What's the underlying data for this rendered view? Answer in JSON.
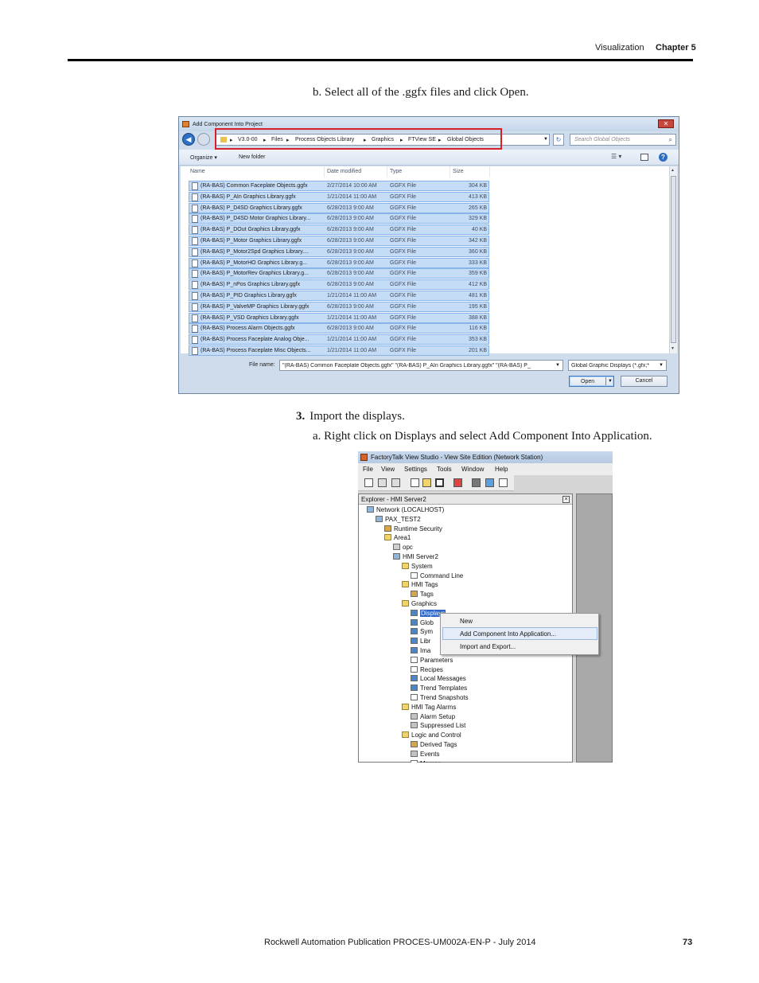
{
  "header": {
    "section": "Visualization",
    "chapter": "Chapter 5"
  },
  "step_b": "b. Select all of the .ggfx files and click Open.",
  "step_3": {
    "num": "3.",
    "text": "Import the displays."
  },
  "step_a": "a. Right click on Displays and select Add Component Into Application.",
  "dialog": {
    "title": "Add Component Into Project",
    "close": "✕",
    "breadcrumbs": [
      "V3.0-00",
      "Files",
      "Process Objects Library",
      "Graphics",
      "FTView SE",
      "Global Objects"
    ],
    "search_placeholder": "Search Global Objects",
    "toolbar": {
      "organize": "Organize ▾",
      "new_folder": "New folder"
    },
    "columns": [
      "Name",
      "Date modified",
      "Type",
      "Size"
    ],
    "files": [
      {
        "name": "(RA-BAS) Common Faceplate Objects.ggfx",
        "date": "2/27/2014 10:00 AM",
        "type": "GGFX File",
        "size": "304 KB"
      },
      {
        "name": "(RA-BAS) P_AIn Graphics Library.ggfx",
        "date": "1/21/2014 11:00 AM",
        "type": "GGFX File",
        "size": "413 KB"
      },
      {
        "name": "(RA-BAS) P_D4SD Graphics Library.ggfx",
        "date": "6/28/2013 9:00 AM",
        "type": "GGFX File",
        "size": "265 KB"
      },
      {
        "name": "(RA-BAS) P_D4SD Motor Graphics Library...",
        "date": "6/28/2013 9:00 AM",
        "type": "GGFX File",
        "size": "329 KB"
      },
      {
        "name": "(RA-BAS) P_DOut Graphics Library.ggfx",
        "date": "6/28/2013 9:00 AM",
        "type": "GGFX File",
        "size": "40 KB"
      },
      {
        "name": "(RA-BAS) P_Motor Graphics Library.ggfx",
        "date": "6/28/2013 9:00 AM",
        "type": "GGFX File",
        "size": "342 KB"
      },
      {
        "name": "(RA-BAS) P_Motor2Spd Graphics Library....",
        "date": "6/28/2013 9:00 AM",
        "type": "GGFX File",
        "size": "360 KB"
      },
      {
        "name": "(RA-BAS) P_MotorHO Graphics Library.g...",
        "date": "6/28/2013 9:00 AM",
        "type": "GGFX File",
        "size": "333 KB"
      },
      {
        "name": "(RA-BAS) P_MotorRev Graphics Library.g...",
        "date": "6/28/2013 9:00 AM",
        "type": "GGFX File",
        "size": "359 KB"
      },
      {
        "name": "(RA-BAS) P_nPos Graphics Library.ggfx",
        "date": "6/28/2013 9:00 AM",
        "type": "GGFX File",
        "size": "412 KB"
      },
      {
        "name": "(RA-BAS) P_PID Graphics Library.ggfx",
        "date": "1/21/2014 11:00 AM",
        "type": "GGFX File",
        "size": "481 KB"
      },
      {
        "name": "(RA-BAS) P_ValveMP Graphics Library.ggfx",
        "date": "6/28/2013 9:00 AM",
        "type": "GGFX File",
        "size": "195 KB"
      },
      {
        "name": "(RA-BAS) P_VSD Graphics Library.ggfx",
        "date": "1/21/2014 11:00 AM",
        "type": "GGFX File",
        "size": "388 KB"
      },
      {
        "name": "(RA-BAS) Process Alarm Objects.ggfx",
        "date": "6/28/2013 9:00 AM",
        "type": "GGFX File",
        "size": "116 KB"
      },
      {
        "name": "(RA-BAS) Process Faceplate Analog Obje...",
        "date": "1/21/2014 11:00 AM",
        "type": "GGFX File",
        "size": "353 KB"
      },
      {
        "name": "(RA-BAS) Process Faceplate Misc Objects...",
        "date": "1/21/2014 11:00 AM",
        "type": "GGFX File",
        "size": "201 KB"
      }
    ],
    "file_name_label": "File name:",
    "file_name_value": "\"(RA-BAS) Common Faceplate Objects.ggfx\" \"(RA-BAS) P_AIn Graphics Library.ggfx\" \"(RA-BAS) P_",
    "file_type_value": "Global Graphic Displays (*.gfx;*",
    "open": "Open",
    "cancel": "Cancel"
  },
  "studio": {
    "title": "FactoryTalk View Studio - View Site Edition (Network Station)",
    "menu": [
      "File",
      "View",
      "Settings",
      "Tools",
      "Window",
      "Help"
    ],
    "explorer_title": "Explorer - HMI Server2",
    "tree": [
      {
        "label": "Network (LOCALHOST)",
        "indent": 0,
        "icon": "net"
      },
      {
        "label": "PAX_TEST2",
        "indent": 1,
        "icon": "net"
      },
      {
        "label": "Runtime Security",
        "indent": 2,
        "icon": "tag"
      },
      {
        "label": "Area1",
        "indent": 2,
        "icon": "folder"
      },
      {
        "label": "opc",
        "indent": 3,
        "icon": "pc"
      },
      {
        "label": "HMI Server2",
        "indent": 3,
        "icon": "net"
      },
      {
        "label": "System",
        "indent": 4,
        "icon": "folder"
      },
      {
        "label": "Command Line",
        "indent": 5,
        "icon": "doc"
      },
      {
        "label": "HMI Tags",
        "indent": 4,
        "icon": "folder"
      },
      {
        "label": "Tags",
        "indent": 5,
        "icon": "tag"
      },
      {
        "label": "Graphics",
        "indent": 4,
        "icon": "folder"
      },
      {
        "label": "Displays",
        "indent": 5,
        "icon": "graph",
        "selected": true
      },
      {
        "label": "Glob",
        "indent": 5,
        "icon": "graph"
      },
      {
        "label": "Sym",
        "indent": 5,
        "icon": "graph"
      },
      {
        "label": "Libr",
        "indent": 5,
        "icon": "graph"
      },
      {
        "label": "Ima",
        "indent": 5,
        "icon": "graph"
      },
      {
        "label": "Parameters",
        "indent": 5,
        "icon": "doc"
      },
      {
        "label": "Recipes",
        "indent": 5,
        "icon": "doc"
      },
      {
        "label": "Local Messages",
        "indent": 5,
        "icon": "graph"
      },
      {
        "label": "Trend Templates",
        "indent": 5,
        "icon": "graph"
      },
      {
        "label": "Trend Snapshots",
        "indent": 5,
        "icon": "doc"
      },
      {
        "label": "HMI Tag Alarms",
        "indent": 4,
        "icon": "folder"
      },
      {
        "label": "Alarm Setup",
        "indent": 5,
        "icon": "alarm"
      },
      {
        "label": "Suppressed List",
        "indent": 5,
        "icon": "alarm"
      },
      {
        "label": "Logic and Control",
        "indent": 4,
        "icon": "folder"
      },
      {
        "label": "Derived Tags",
        "indent": 5,
        "icon": "tag"
      },
      {
        "label": "Events",
        "indent": 5,
        "icon": "alarm"
      },
      {
        "label": "Macros",
        "indent": 5,
        "icon": "doc"
      }
    ],
    "context_menu": [
      "New",
      "Add Component Into Application...",
      "Import and Export..."
    ]
  },
  "footer": {
    "publication": "Rockwell Automation Publication PROCES-UM002A-EN-P - July 2014",
    "page": "73"
  }
}
